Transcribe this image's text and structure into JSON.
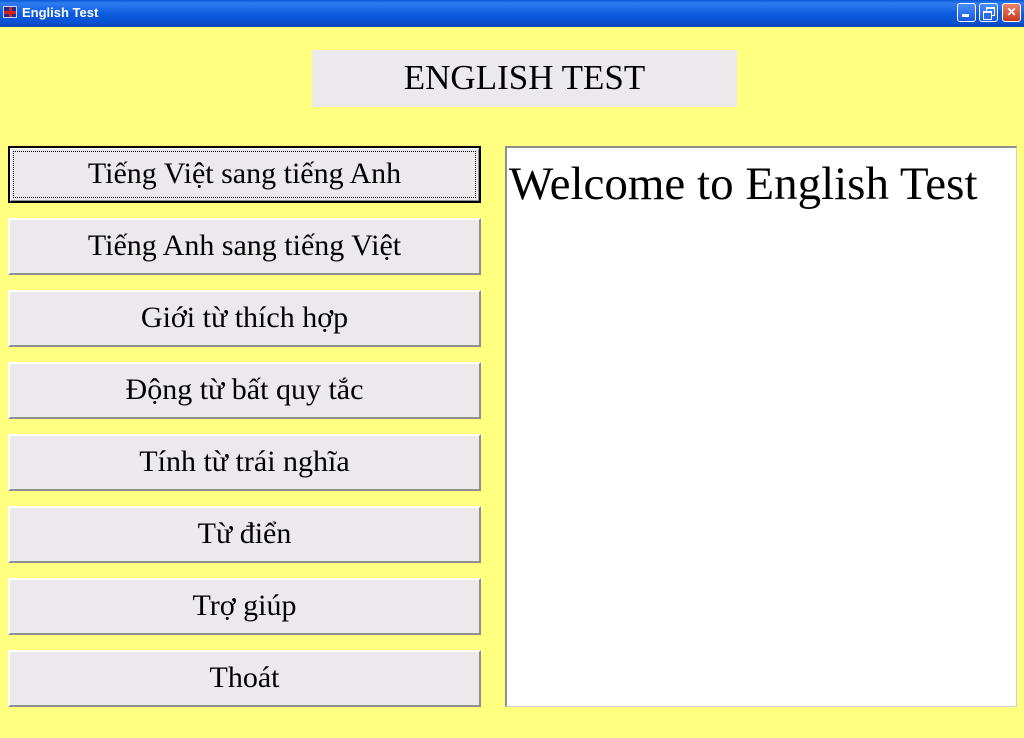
{
  "window": {
    "title": "English Test",
    "minimize_label": "",
    "maximize_label": "",
    "close_label": "✕"
  },
  "header": {
    "title": "ENGLISH TEST"
  },
  "menu": [
    {
      "label": "Tiếng Việt sang tiếng Anh",
      "focused": true
    },
    {
      "label": "Tiếng Anh sang tiếng Việt"
    },
    {
      "label": "Giới từ thích hợp"
    },
    {
      "label": "Động từ bất quy tắc"
    },
    {
      "label": "Tính từ trái nghĩa"
    },
    {
      "label": "Từ điển"
    },
    {
      "label": "Trợ giúp"
    },
    {
      "label": "Thoát"
    }
  ],
  "content": {
    "welcome_text": "Welcome to English Test"
  },
  "colors": {
    "background": "#FFFF80",
    "button_face": "#ECE9EC",
    "titlebar": "#0A58D8",
    "panel": "#FFFFFF"
  }
}
